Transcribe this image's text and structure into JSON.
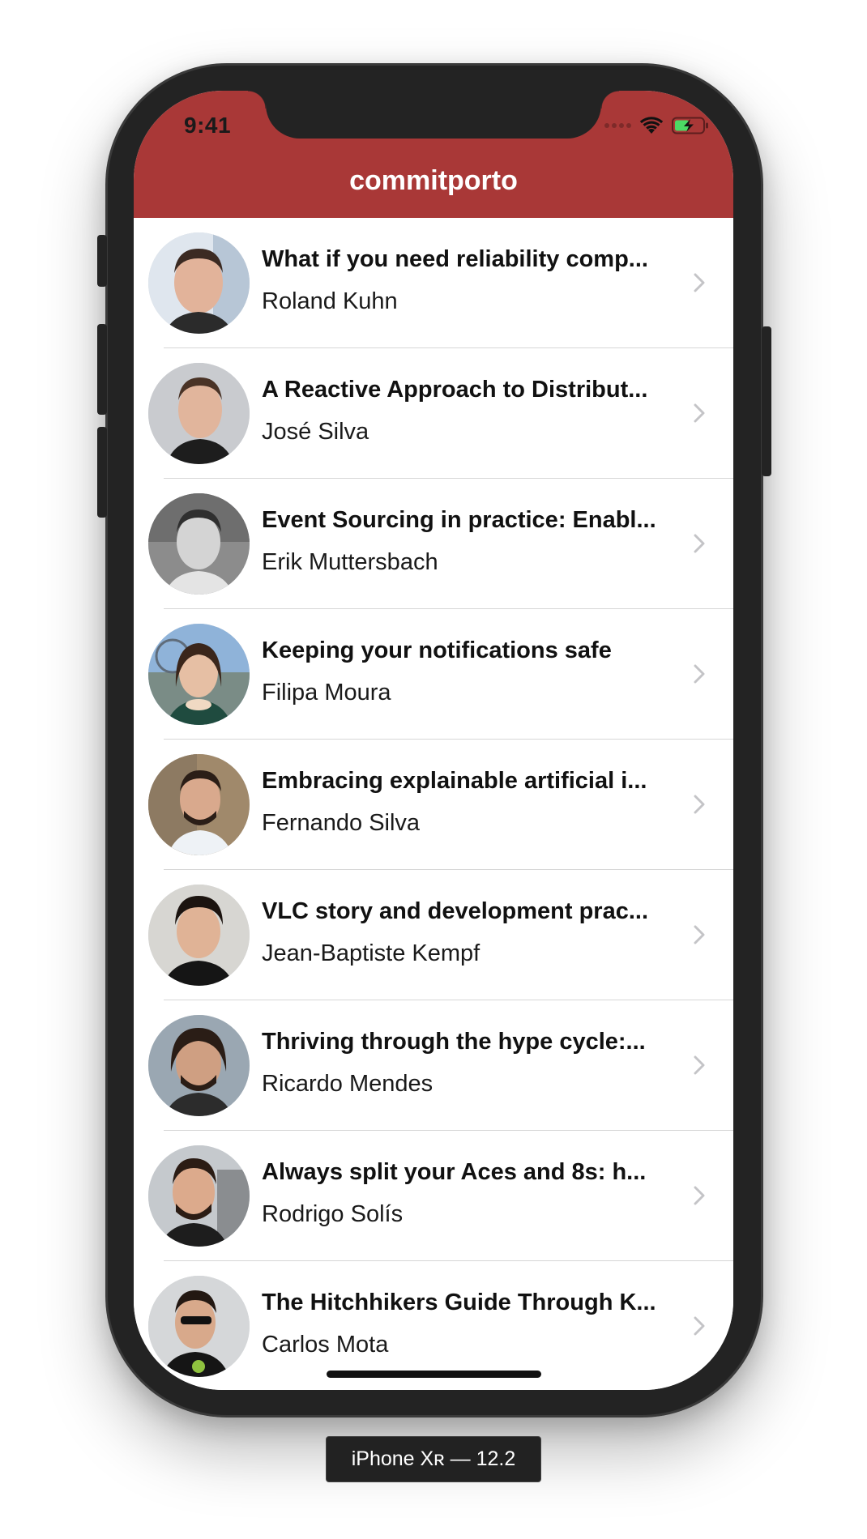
{
  "status_bar": {
    "time": "9:41",
    "icons": [
      "signal-icon",
      "wifi-icon",
      "battery-charging-icon"
    ]
  },
  "nav": {
    "title": "commitporto",
    "background": "#a93837"
  },
  "talks": [
    {
      "title": "What if you need reliability comp...",
      "speaker": "Roland Kuhn"
    },
    {
      "title": "A Reactive Approach to Distribut...",
      "speaker": "José Silva"
    },
    {
      "title": "Event Sourcing in practice: Enabl...",
      "speaker": "Erik Muttersbach"
    },
    {
      "title": "Keeping your notifications safe",
      "speaker": "Filipa Moura"
    },
    {
      "title": "Embracing explainable artificial i...",
      "speaker": "Fernando Silva"
    },
    {
      "title": "VLC story and development prac...",
      "speaker": "Jean-Baptiste Kempf"
    },
    {
      "title": "Thriving through the hype cycle:...",
      "speaker": "Ricardo Mendes"
    },
    {
      "title": "Always split your Aces and 8s: h...",
      "speaker": "Rodrigo Solís"
    },
    {
      "title": "The Hitchhikers Guide Through K...",
      "speaker": "Carlos Mota"
    }
  ],
  "device_label": "iPhone Xʀ — 12.2"
}
